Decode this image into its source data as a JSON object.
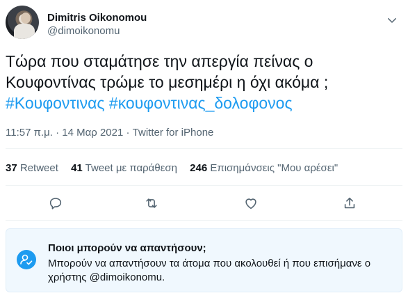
{
  "tweet": {
    "author_name": "Dimitris Oikonomou",
    "author_handle": "@dimoikonomu",
    "text_line1": "Τώρα που σταμάτησε την απεργία πείνας  ο",
    "text_line2": "Κουφοντίνας τρώμε το μεσημέρι η όχι ακόμα ;",
    "hashtag1": "#Κουφοντινας",
    "hashtag2": "#κουφοντινας_δολοφονος",
    "timestamp": "11:57 π.μ. · 14 Μαρ 2021 · Twitter for iPhone"
  },
  "stats": {
    "retweets_count": "37",
    "retweets_label": "Retweet",
    "quotes_count": "41",
    "quotes_label": "Tweet με παράθεση",
    "likes_count": "246",
    "likes_label": "Επισημάνσεις \"Μου αρέσει\""
  },
  "actions": [
    "reply-icon",
    "retweet-icon",
    "like-icon",
    "share-icon"
  ],
  "reply_notice": {
    "title": "Ποιοι μπορούν να απαντήσουν;",
    "body": "Μπορούν να απαντήσουν τα άτομα που ακολουθεί ή που επισήμανε ο χρήστης @dimoikonomu."
  },
  "colors": {
    "accent": "#1d9bf0",
    "secondary_text": "#536471",
    "notice_bg": "#f0f8fe"
  }
}
